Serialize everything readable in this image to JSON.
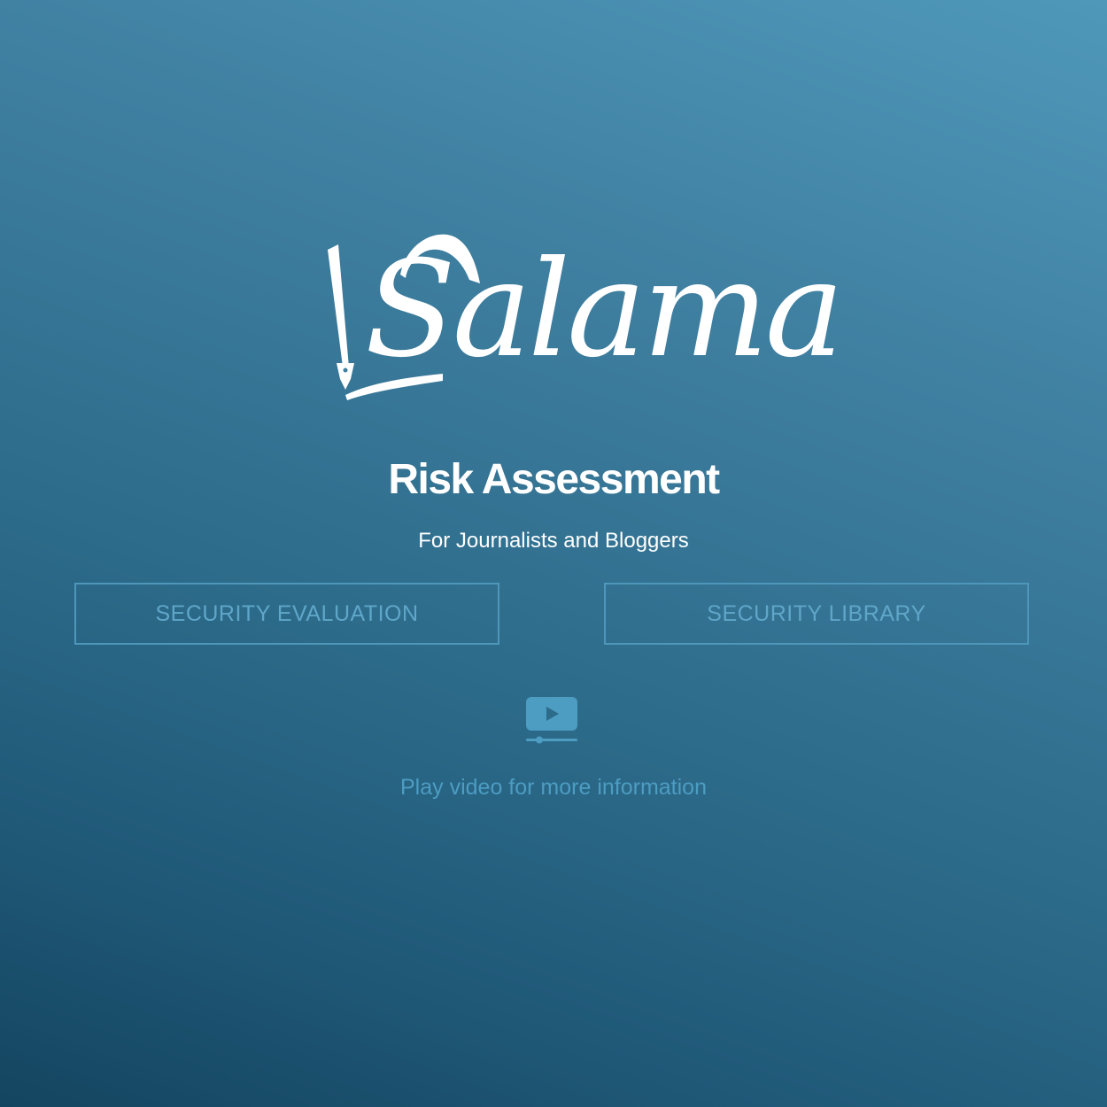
{
  "brand": {
    "logo_text": "Salama",
    "logo_color": "#ffffff"
  },
  "hero": {
    "title": "Risk Assessment",
    "subtitle": "For Journalists and Bloggers"
  },
  "actions": {
    "security_evaluation_label": "SECURITY EVALUATION",
    "security_library_label": "SECURITY LIBRARY"
  },
  "video": {
    "icon": "play-video-icon",
    "label": "Play video for more information"
  },
  "colors": {
    "background_top": "#4f98ba",
    "background_bottom": "#144560",
    "button_border": "#4e97ba",
    "button_text": "#5fa6c8",
    "link_text": "#4d9cc2"
  }
}
